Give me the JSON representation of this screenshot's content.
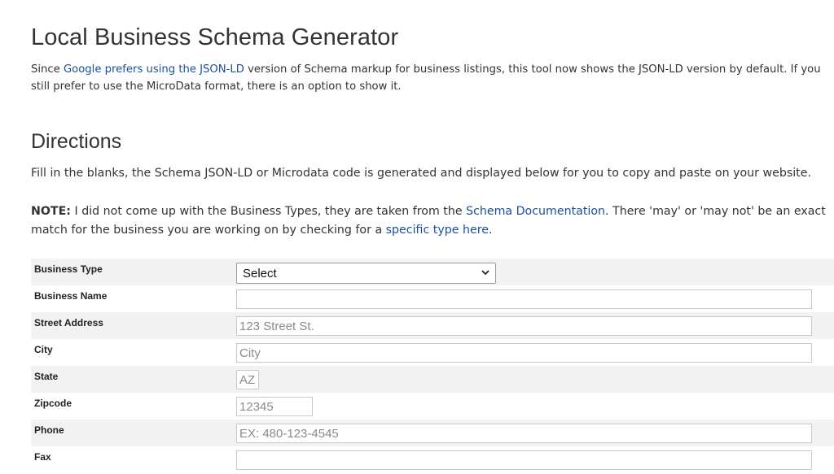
{
  "page": {
    "title": "Local Business Schema Generator",
    "intro": {
      "before_link": "Since ",
      "link": "Google prefers using the JSON-LD",
      "after_link": " version of Schema markup for business listings, this tool now shows the JSON-LD version by default. If you still prefer to use the MicroData format, there is an option to show it."
    },
    "directions_heading": "Directions",
    "directions_text": "Fill in the blanks, the Schema JSON-LD or Microdata code is generated and displayed below for you to copy and paste on your website.",
    "note": {
      "label": "NOTE:",
      "text1": " I did not come up with the Business Types, they are taken from the ",
      "link1": "Schema Documentation",
      "text2": ". There 'may' or 'may not' be an exact match for the business you are working on by checking for a ",
      "link2": "specific type here",
      "text3": "."
    }
  },
  "form": {
    "business_type": {
      "label": "Business Type",
      "selected": "Select"
    },
    "business_name": {
      "label": "Business Name",
      "value": "",
      "placeholder": ""
    },
    "street_address": {
      "label": "Street Address",
      "value": "",
      "placeholder": "123 Street St."
    },
    "city": {
      "label": "City",
      "value": "",
      "placeholder": "City"
    },
    "state": {
      "label": "State",
      "value": "",
      "placeholder": "AZ"
    },
    "zipcode": {
      "label": "Zipcode",
      "value": "",
      "placeholder": "12345"
    },
    "phone": {
      "label": "Phone",
      "value": "",
      "placeholder": "EX: 480-123-4545"
    },
    "fax": {
      "label": "Fax",
      "value": "",
      "placeholder": ""
    }
  },
  "colors": {
    "link": "#1a4fa0",
    "row_shade": "#f2f2f2",
    "text": "#333333"
  }
}
